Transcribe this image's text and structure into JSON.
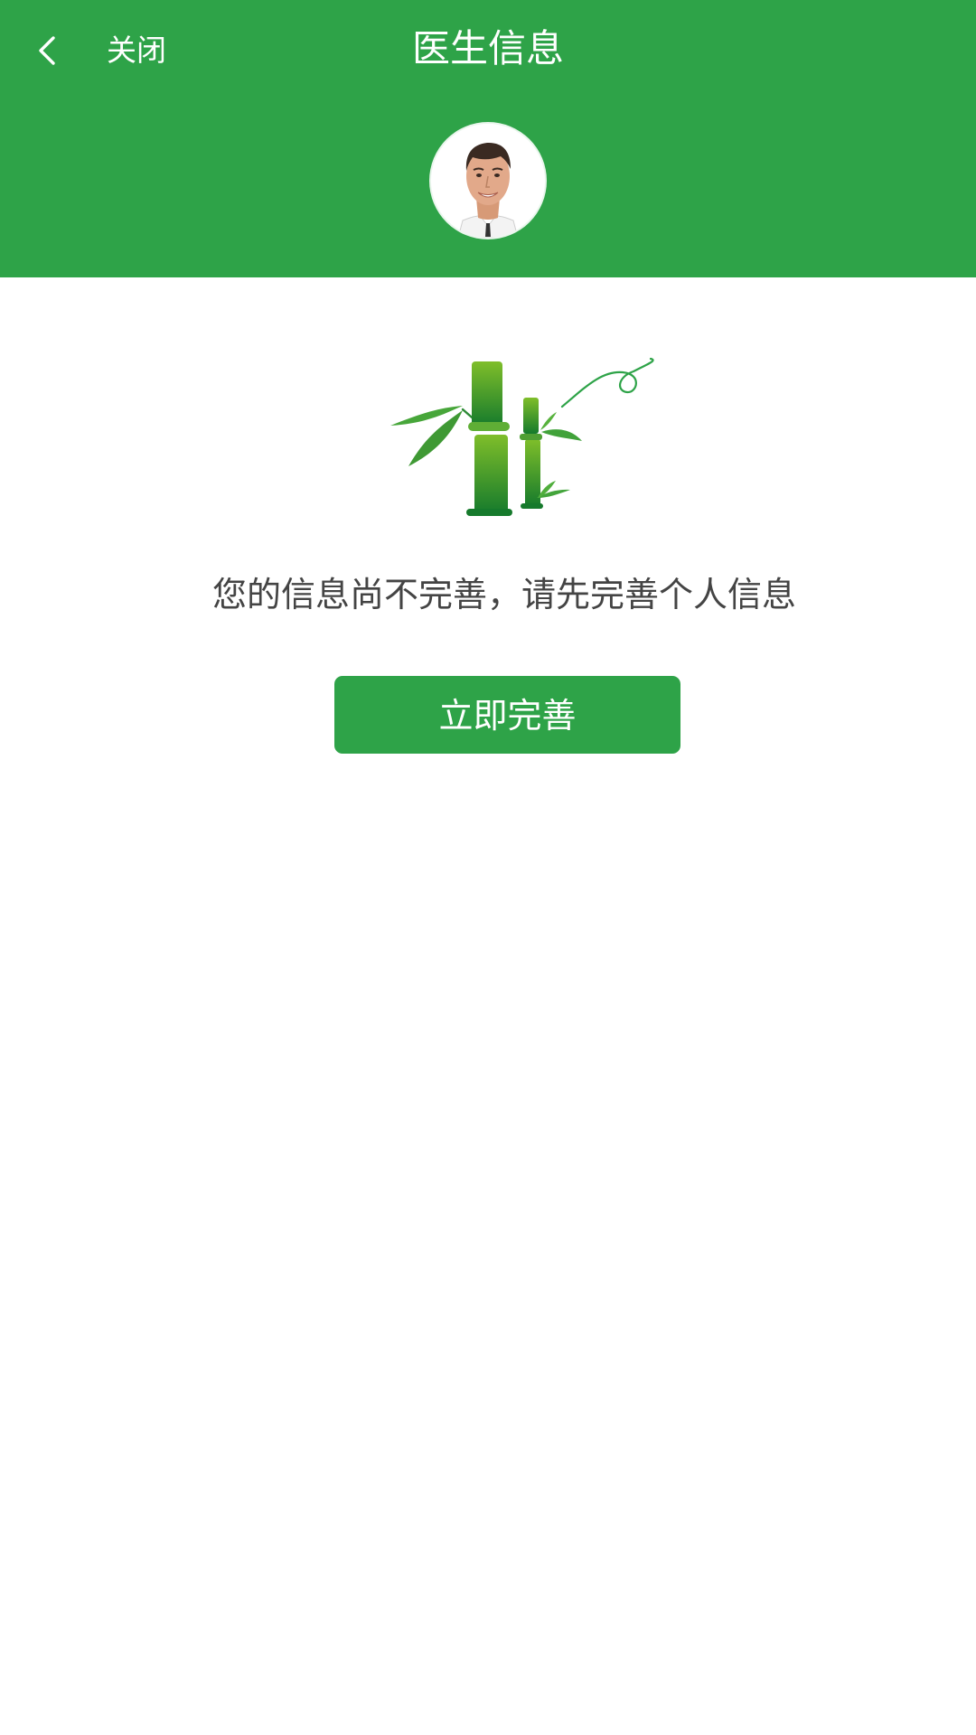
{
  "header": {
    "back_icon": "chevron-left-icon",
    "close_label": "关闭",
    "title": "医生信息",
    "avatar_icon": "doctor-avatar",
    "background_color": "#2ea348"
  },
  "main": {
    "illustration_icon": "bamboo-illustration",
    "notice": "您的信息尚不完善，请先完善个人信息",
    "action_button_label": "立即完善"
  },
  "colors": {
    "primary": "#2ea348",
    "text": "#444444",
    "background": "#ffffff"
  }
}
